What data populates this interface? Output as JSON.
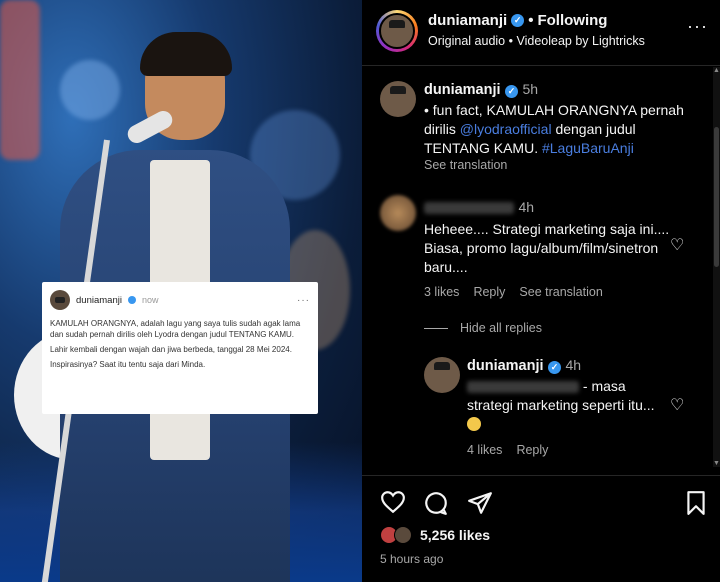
{
  "header": {
    "username": "duniamanji",
    "follow_label": "Following",
    "audio": "Original audio",
    "audio_separator": "•",
    "audio_source": "Videoleap by Lightricks"
  },
  "embedded_post": {
    "username": "duniamanji",
    "time": "now",
    "paragraphs": [
      "KAMULAH ORANGNYA, adalah lagu yang saya tulis sudah agak lama dan sudah pernah dirilis oleh Lyodra dengan judul TENTANG KAMU.",
      "Lahir kembali dengan wajah dan jiwa berbeda, tanggal 28 Mei 2024.",
      "Inspirasinya? Saat itu tentu saja dari Minda."
    ]
  },
  "caption": {
    "username": "duniamanji",
    "time": "5h",
    "text_part1": "• fun fact, KAMULAH ORANGNYA pernah dirilis ",
    "mention": "@lyodraofficial",
    "text_part2": " dengan judul TENTANG KAMU. ",
    "hashtag": "#LaguBaruAnji",
    "see_translation": "See translation"
  },
  "comment1": {
    "time": "4h",
    "text": "Heheee.... Strategi marketing saja ini.... Biasa, promo lagu/album/film/sinetron baru....",
    "likes": "3 likes",
    "reply": "Reply",
    "see_translation": "See translation",
    "hide_replies": "Hide all replies"
  },
  "reply1": {
    "username": "duniamanji",
    "time": "4h",
    "text": " - masa strategi marketing seperti itu... ",
    "likes": "4 likes",
    "reply": "Reply"
  },
  "footer": {
    "likes": "5,256 likes",
    "posted": "5 hours ago"
  },
  "icons": {
    "verified": "verified-badge-icon",
    "more": "more-options-icon",
    "heart": "heart-icon",
    "comment": "comment-icon",
    "share": "share-icon",
    "bookmark": "bookmark-icon"
  },
  "colors": {
    "background": "#000000",
    "link": "#4a7ee0",
    "verified": "#3897f0",
    "secondary_text": "#a8a8a8"
  }
}
